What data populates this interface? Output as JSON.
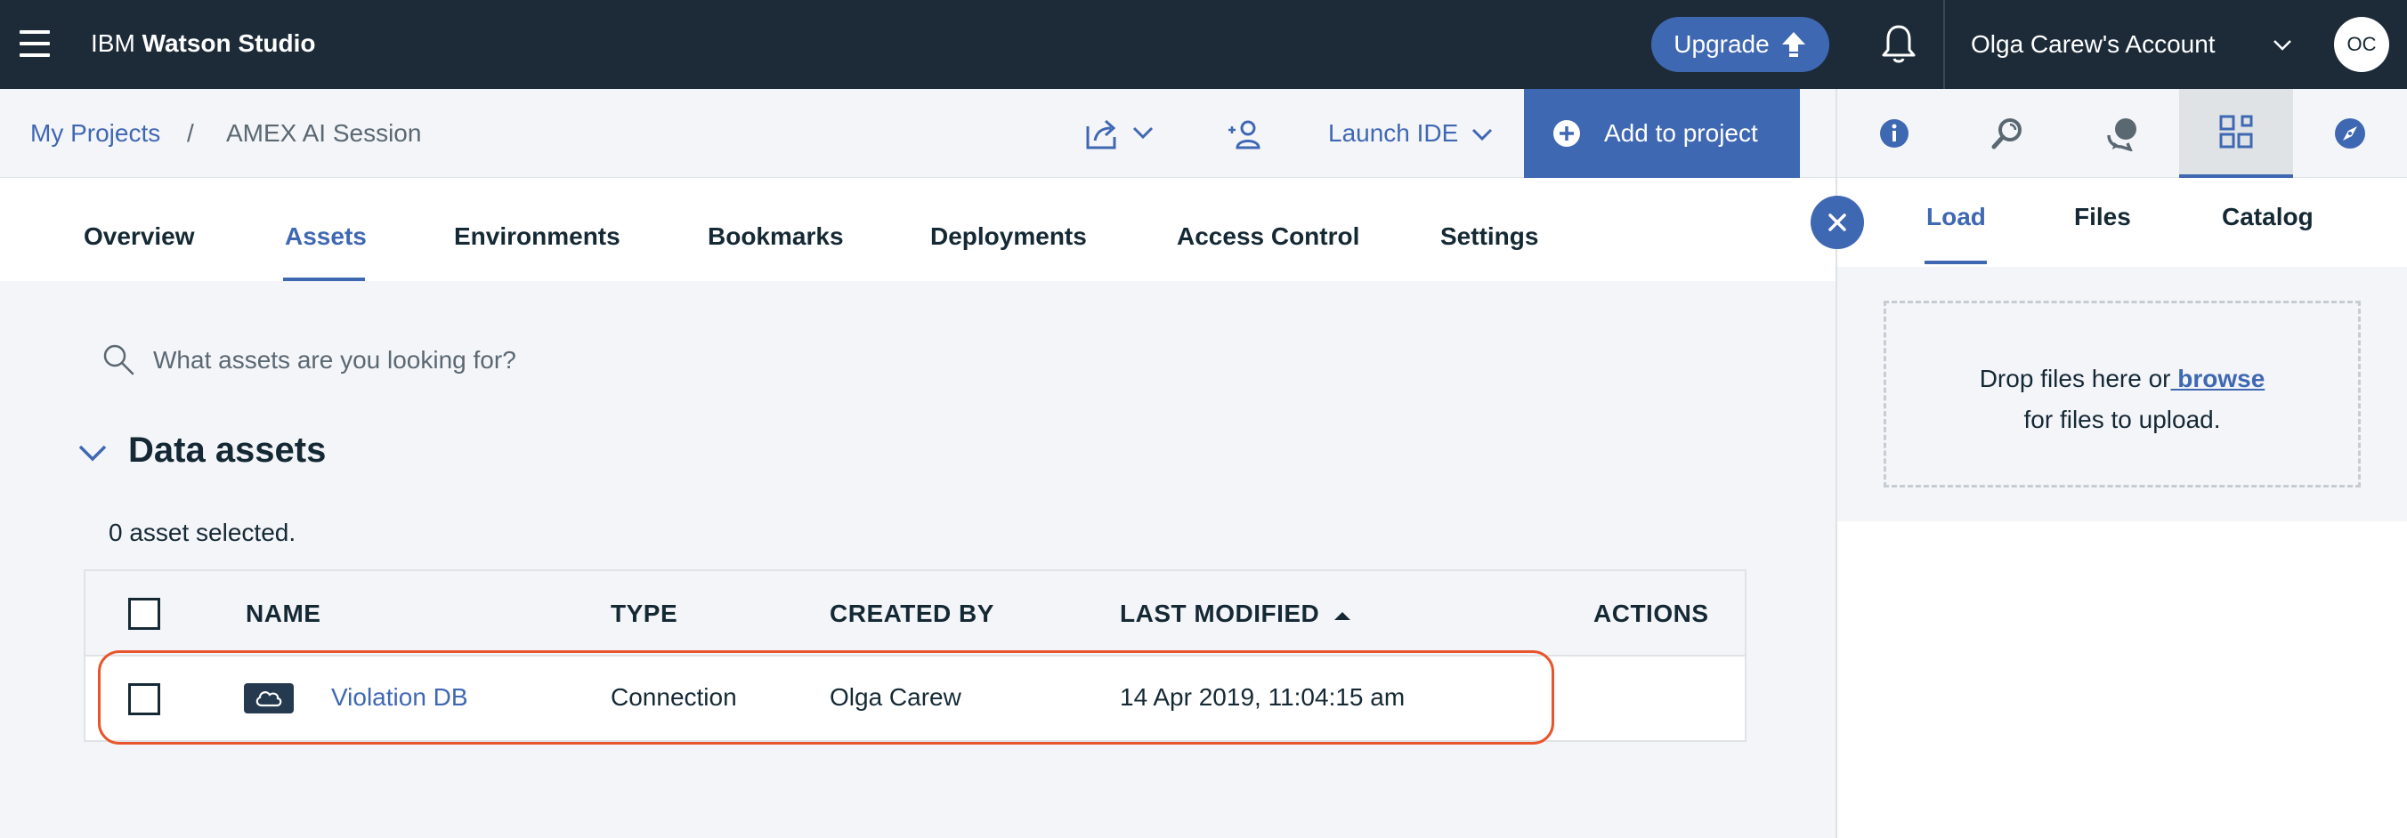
{
  "topbar": {
    "brand_prefix": "IBM ",
    "brand_name": "Watson Studio",
    "upgrade_label": "Upgrade",
    "account_name": "Olga Carew's Account",
    "avatar_initials": "OC"
  },
  "breadcrumb": {
    "root": "My Projects",
    "separator": "/",
    "current": "AMEX AI Session"
  },
  "toolbar": {
    "launch_ide_label": "Launch IDE",
    "add_to_project_label": "Add to project"
  },
  "tabs": [
    {
      "label": "Overview"
    },
    {
      "label": "Assets"
    },
    {
      "label": "Environments"
    },
    {
      "label": "Bookmarks"
    },
    {
      "label": "Deployments"
    },
    {
      "label": "Access Control"
    },
    {
      "label": "Settings"
    }
  ],
  "active_tab": "Assets",
  "search": {
    "placeholder": "What assets are you looking for?",
    "value": ""
  },
  "data_assets": {
    "title": "Data assets",
    "selection_status": "0 asset selected.",
    "columns": [
      "NAME",
      "TYPE",
      "CREATED BY",
      "LAST MODIFIED",
      "ACTIONS"
    ],
    "sort_column": "LAST MODIFIED",
    "sort_direction": "ascending",
    "rows": [
      {
        "name": "Violation DB",
        "type": "Connection",
        "created_by": "Olga Carew",
        "last_modified": "14 Apr 2019, 11:04:15 am",
        "icon": "cloud-icon",
        "highlighted": true
      }
    ]
  },
  "side_panel": {
    "tabs": [
      {
        "label": "Load"
      },
      {
        "label": "Files"
      },
      {
        "label": "Catalog"
      }
    ],
    "active_tab": "Load",
    "drop_text_before": "Drop files here or",
    "browse_label": " browse",
    "drop_text_after": "for files to upload."
  },
  "colors": {
    "topbar_bg": "#1d2b38",
    "accent": "#3f68b3",
    "highlight_border": "#e8542b",
    "page_bg": "#f4f5f9"
  },
  "icons": {
    "panel_tools": [
      "info-icon",
      "find-icon",
      "community-icon",
      "data-icon",
      "compass-icon"
    ],
    "active_panel_tool": "data-icon"
  }
}
